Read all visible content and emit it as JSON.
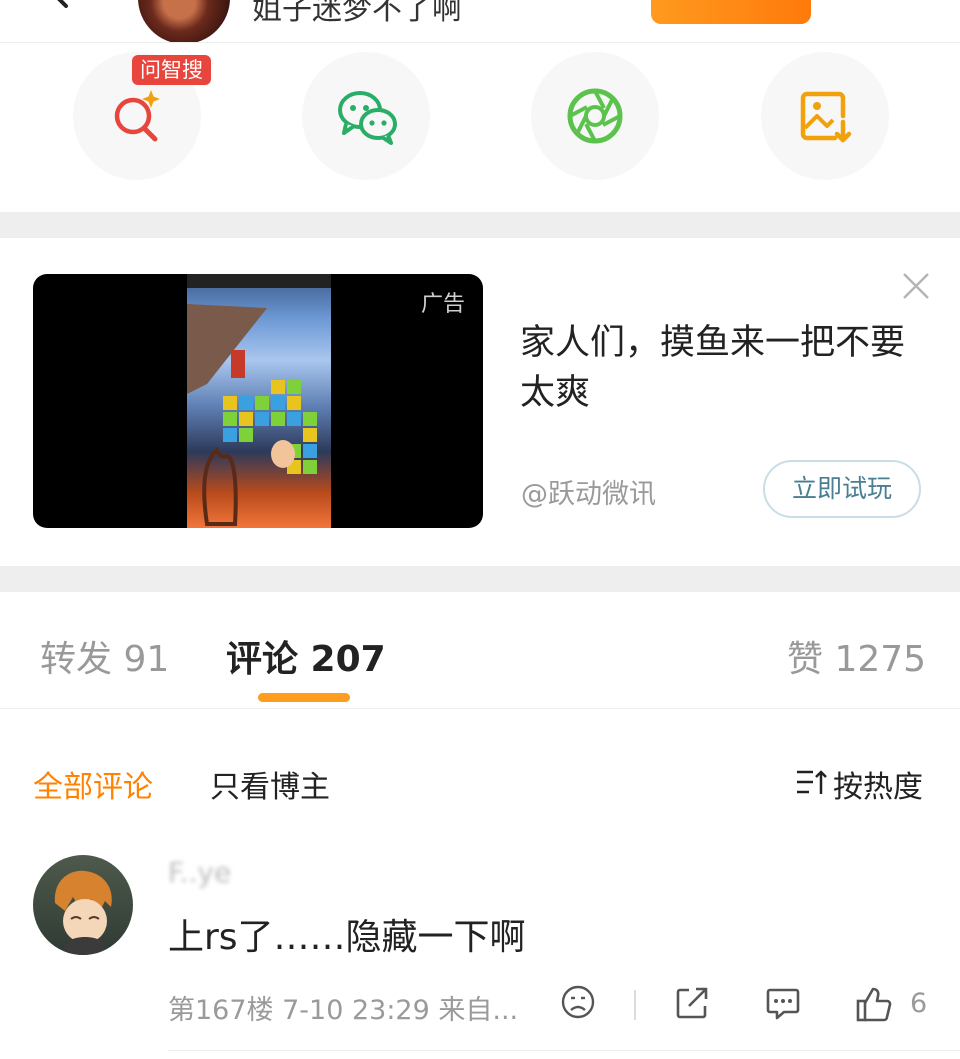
{
  "header": {
    "back_icon": "chevron-left-icon",
    "username_partial": "姐子迷梦不了啊",
    "follow_button": ""
  },
  "share": {
    "badge": "问智搜",
    "items": [
      {
        "icon": "ai-search-icon",
        "color": "#e8453c"
      },
      {
        "icon": "wechat-icon",
        "color": "#2aae67"
      },
      {
        "icon": "moments-icon",
        "color": "#5bc24c"
      },
      {
        "icon": "save-image-icon",
        "color": "#f0a10b"
      }
    ]
  },
  "ad": {
    "label": "广告",
    "title": "家人们，摸鱼来一把不要太爽",
    "source": "@跃动微讯",
    "cta": "立即试玩"
  },
  "tabs": {
    "repost": "转发 91",
    "comments": "评论 207",
    "likes": "赞 1275",
    "accent": "#ff9d21"
  },
  "filters": {
    "all": "全部评论",
    "author_only": "只看博主",
    "sort": "按热度",
    "accent": "#ff8200"
  },
  "comment": {
    "author": "F..ye",
    "text": "上rs了……隐藏一下啊",
    "meta": "第167楼  7-10 23:29  来自...",
    "like_count": "6"
  }
}
